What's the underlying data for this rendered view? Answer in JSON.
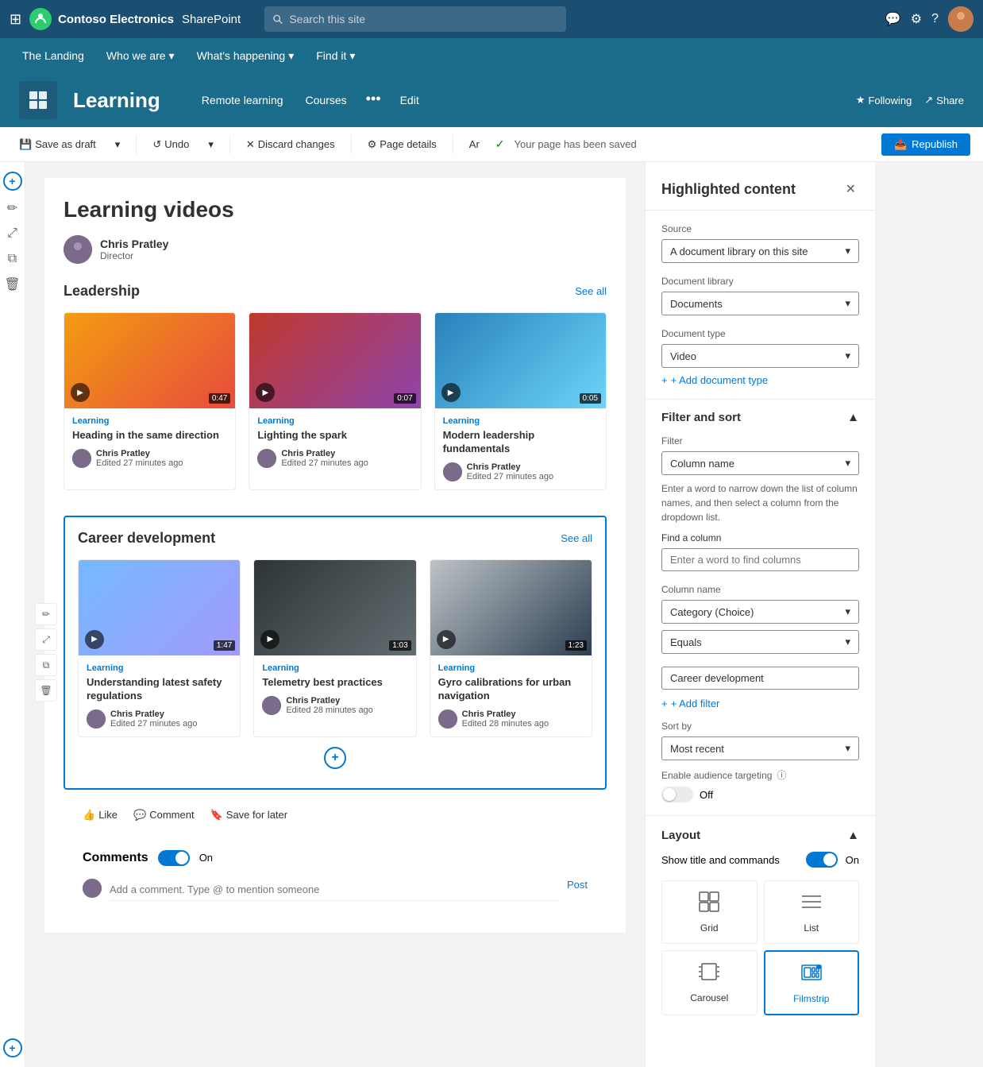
{
  "topNav": {
    "waffle": "⊞",
    "brandName": "Contoso Electronics",
    "appName": "SharePoint",
    "searchPlaceholder": "Search this site",
    "icons": {
      "chat": "💬",
      "settings": "⚙",
      "help": "?"
    }
  },
  "siteNav": {
    "items": [
      {
        "label": "The Landing"
      },
      {
        "label": "Who we are",
        "hasDropdown": true
      },
      {
        "label": "What's happening",
        "hasDropdown": true
      },
      {
        "label": "Find it",
        "hasDropdown": true
      }
    ]
  },
  "pageHeader": {
    "title": "Learning",
    "navItems": [
      {
        "label": "Remote learning"
      },
      {
        "label": "Courses"
      }
    ],
    "dotsLabel": "•••",
    "editLabel": "Edit",
    "followingLabel": "Following",
    "shareLabel": "Share"
  },
  "toolbar": {
    "saveLabel": "Save as draft",
    "undoLabel": "Undo",
    "discardLabel": "Discard changes",
    "pageDetailsLabel": "Page details",
    "autoSaveLabel": "Ar",
    "savedMessage": "Your page has been saved",
    "republishLabel": "Republish"
  },
  "pageContent": {
    "title": "Learning videos",
    "author": {
      "name": "Chris Pratley",
      "title": "Director"
    },
    "sections": [
      {
        "id": "leadership",
        "title": "Leadership",
        "seeAll": "See all",
        "cards": [
          {
            "tag": "Learning",
            "title": "Heading in the same direction",
            "duration": "0:47",
            "author": "Chris Pratley",
            "time": "Edited 27 minutes ago",
            "thumbClass": "thumb-orange"
          },
          {
            "tag": "Learning",
            "title": "Lighting the spark",
            "duration": "0:07",
            "author": "Chris Pratley",
            "time": "Edited 27 minutes ago",
            "thumbClass": "thumb-red"
          },
          {
            "tag": "Learning",
            "title": "Modern leadership fundamentals",
            "duration": "0:05",
            "author": "Chris Pratley",
            "time": "Edited 27 minutes ago",
            "thumbClass": "thumb-blue"
          }
        ]
      },
      {
        "id": "career",
        "title": "Career development",
        "seeAll": "See all",
        "cards": [
          {
            "tag": "Learning",
            "title": "Understanding latest safety regulations",
            "duration": "1:47",
            "author": "Chris Pratley",
            "time": "Edited 27 minutes ago",
            "thumbClass": "thumb-drone"
          },
          {
            "tag": "Learning",
            "title": "Telemetry best practices",
            "duration": "1:03",
            "author": "Chris Pratley",
            "time": "Edited 28 minutes ago",
            "thumbClass": "thumb-telemetry"
          },
          {
            "tag": "Learning",
            "title": "Gyro calibrations for urban navigation",
            "duration": "1:23",
            "author": "Chris Pratley",
            "time": "Edited 28 minutes ago",
            "thumbClass": "thumb-city"
          }
        ]
      }
    ]
  },
  "bottomActions": {
    "likeLabel": "Like",
    "commentLabel": "Comment",
    "saveLabel": "Save for later"
  },
  "comments": {
    "title": "Comments",
    "toggleLabel": "On",
    "placeholder": "Add a comment. Type @ to mention someone",
    "postLabel": "Post"
  },
  "rightPanel": {
    "title": "Highlighted content",
    "source": {
      "label": "Source",
      "value": "A document library on this site"
    },
    "docLibrary": {
      "label": "Document library",
      "value": "Documents"
    },
    "docType": {
      "label": "Document type",
      "value": "Video"
    },
    "addDocTypeLabel": "+ Add document type",
    "filterSort": {
      "title": "Filter and sort",
      "filterLabel": "Filter",
      "filterValue": "Column name",
      "filterHint": "Enter a word to narrow down the list of column names, and then select a column from the dropdown list.",
      "findColumnLabel": "Find a column",
      "findColumnPlaceholder": "Enter a word to find columns",
      "columnNameLabel": "Column name",
      "columnNameValue": "Category (Choice)",
      "equalsValue": "Equals",
      "filterValueInput": "Career development",
      "addFilterLabel": "+ Add filter",
      "sortByLabel": "Sort by",
      "sortByValue": "Most recent",
      "audienceLabel": "Enable audience targeting",
      "audienceToggle": "Off"
    },
    "layout": {
      "title": "Layout",
      "showTitleLabel": "Show title and commands",
      "showTitleToggle": "On",
      "options": [
        {
          "id": "grid",
          "label": "Grid",
          "icon": "⊞",
          "selected": false
        },
        {
          "id": "list",
          "label": "List",
          "icon": "≡",
          "selected": false
        },
        {
          "id": "carousel",
          "label": "Carousel",
          "icon": "◫",
          "selected": false
        },
        {
          "id": "filmstrip",
          "label": "Filmstrip",
          "icon": "▦",
          "selected": true
        }
      ]
    }
  }
}
